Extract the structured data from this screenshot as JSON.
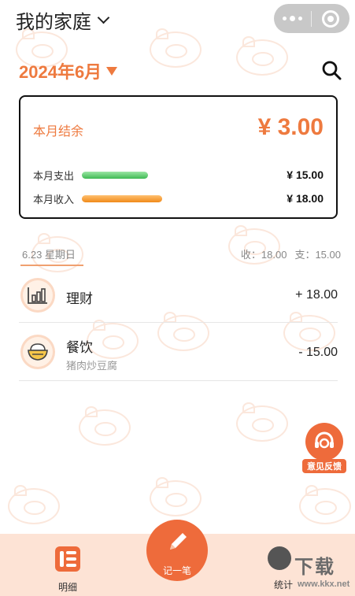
{
  "header": {
    "family_title": "我的家庭",
    "month_label": "2024年6月"
  },
  "summary": {
    "balance_label": "本月结余",
    "balance_value": "¥ 3.00",
    "expense_label": "本月支出",
    "expense_value": "¥ 15.00",
    "income_label": "本月收入",
    "income_value": "¥ 18.00"
  },
  "day_group": {
    "date": "6.23 星期日",
    "income": "收：18.00",
    "expense": "支：15.00",
    "items": [
      {
        "title": "理财",
        "subtitle": "",
        "amount": "+ 18.00",
        "icon": "bar-chart-icon"
      },
      {
        "title": "餐饮",
        "subtitle": "猪肉炒豆腐",
        "amount": "- 15.00",
        "icon": "rice-bowl-icon"
      }
    ]
  },
  "feedback": {
    "label": "意见反馈"
  },
  "nav": {
    "detail_label": "明细",
    "add_label": "记一笔",
    "stats_label": "统计"
  },
  "watermark": {
    "text": "下载",
    "url": "www.kkx.net"
  },
  "colors": {
    "accent": "#ee7a3f",
    "nav_bg": "#fde3d5",
    "expense_bar": "#3fba54",
    "income_bar": "#f08a1a"
  }
}
